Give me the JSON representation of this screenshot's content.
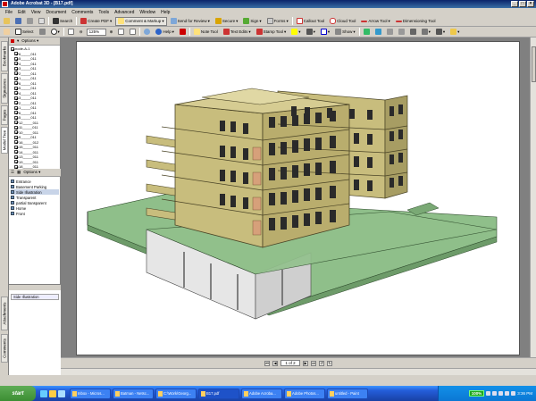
{
  "window": {
    "title": "Adobe Acrobat 3D - [B17.pdf]"
  },
  "menu": [
    "File",
    "Edit",
    "View",
    "Document",
    "Comments",
    "Tools",
    "Advanced",
    "Window",
    "Help"
  ],
  "toolbar1": {
    "search": "Search",
    "create_pdf": "Create PDF",
    "comment_markup": "Comment & Markup",
    "send_review": "Send for Review",
    "secure": "Secure",
    "sign": "Sign",
    "forms": "Forms",
    "callout": "Callout Tool",
    "cloud": "Cloud Tool",
    "arrow": "Arrow Tool",
    "dimensioning": "Dimensioning Tool"
  },
  "toolbar2": {
    "select": "Select",
    "zoom": "125%",
    "help": "Help",
    "note": "Note Tool",
    "text_edits": "Text Edits",
    "stamp": "Stamp Tool",
    "show": "Show"
  },
  "vtabs": [
    "Bookmarks",
    "Signatures",
    "Pages",
    "Model Tree",
    "Attachments",
    "Comments"
  ],
  "tree": {
    "options": "Options",
    "root": "node-A-1",
    "items": [
      "6_____011",
      "5_____011",
      "4_____011",
      "3_____011",
      "2_____011",
      "1_____011",
      "6_____011",
      "5_____011",
      "4_____011",
      "3_____011",
      "2_____011",
      "1_____011",
      "6_____011",
      "5_____011",
      "12_____011",
      "11_____011",
      "10_____011",
      "9_____011",
      "16_____012",
      "15_____011",
      "14_____011",
      "13_____011",
      "19_____011",
      "18_____011",
      "17_____011"
    ]
  },
  "views": {
    "options": "Options",
    "items": [
      "Entrance",
      "Basement Parking",
      "Side Illustration",
      "Transparent",
      "partial transparent",
      "Home",
      "Front"
    ],
    "selected_index": 2
  },
  "slides": {
    "items": [
      "Side Illustration"
    ]
  },
  "pagenav": {
    "current": "1 of 2"
  },
  "taskbar": {
    "start": "start",
    "tasks": [
      "Inbox - Micros...",
      "Batman - Netsc...",
      "C:\\Work\\Georg...",
      "B17.pdf",
      "Adobe Acroba...",
      "Adobe Photos...",
      "untitled - Paint"
    ],
    "active_index": 3,
    "zoom_pct": "100%",
    "time": "3:36 PM"
  },
  "colors": {
    "facade": "#c8bd7d",
    "facade_dark": "#8e8553",
    "lawn": "#8fbf8a",
    "lawn_dark": "#6d9b69",
    "glass": "#d6a07a"
  }
}
